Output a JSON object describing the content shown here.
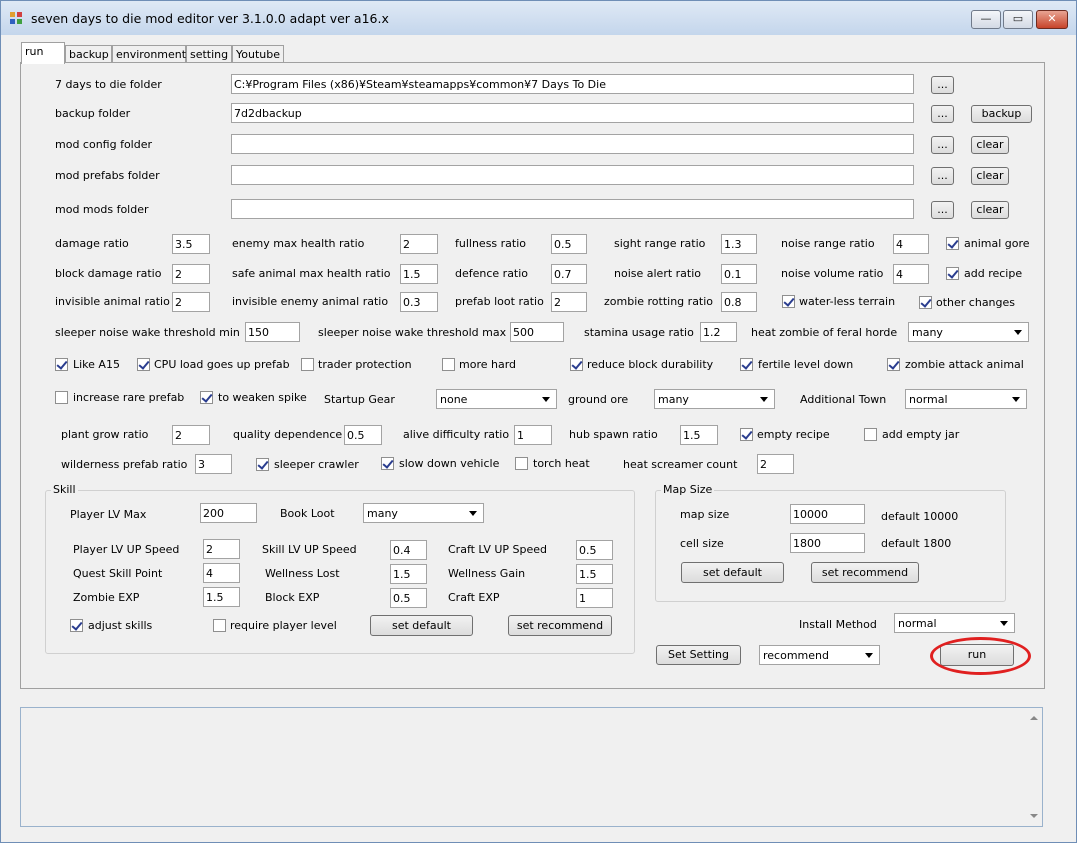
{
  "window": {
    "title": "seven days to die mod editor ver 3.1.0.0 adapt ver a16.x",
    "minimize_glyph": "—",
    "maximize_glyph": "▭",
    "close_glyph": "✕"
  },
  "tabs": [
    "run",
    "backup",
    "environment",
    "setting",
    "Youtube"
  ],
  "folders": [
    {
      "label": "7 days to die folder",
      "value": "C:¥Program Files (x86)¥Steam¥steamapps¥common¥7 Days To Die",
      "browse": "...",
      "action": ""
    },
    {
      "label": "backup folder",
      "value": "7d2dbackup",
      "browse": "...",
      "action": "backup"
    },
    {
      "label": "mod config folder",
      "value": "",
      "browse": "...",
      "action": "clear"
    },
    {
      "label": "mod prefabs folder",
      "value": "",
      "browse": "...",
      "action": "clear"
    },
    {
      "label": "mod mods folder",
      "value": "",
      "browse": "...",
      "action": "clear"
    }
  ],
  "ratios_row1": [
    {
      "label": "damage ratio",
      "value": "3.5"
    },
    {
      "label": "enemy max health ratio",
      "value": "2"
    },
    {
      "label": "fullness ratio",
      "value": "0.5"
    },
    {
      "label": "sight range ratio",
      "value": "1.3"
    },
    {
      "label": "noise range ratio",
      "value": "4"
    }
  ],
  "ratios_row2": [
    {
      "label": "block damage ratio",
      "value": "2"
    },
    {
      "label": "safe animal max health ratio",
      "value": "1.5"
    },
    {
      "label": "defence ratio",
      "value": "0.7"
    },
    {
      "label": "noise alert ratio",
      "value": "0.1"
    },
    {
      "label": "noise volume ratio",
      "value": "4"
    }
  ],
  "ratios_row3": [
    {
      "label": "invisible animal ratio",
      "value": "2"
    },
    {
      "label": "invisible enemy animal ratio",
      "value": "0.3"
    },
    {
      "label": "prefab loot ratio",
      "value": "2"
    },
    {
      "label": "zombie rotting ratio",
      "value": "0.8"
    }
  ],
  "side_checks": {
    "animal_gore": {
      "label": "animal gore",
      "checked": true
    },
    "add_recipe": {
      "label": "add recipe",
      "checked": true
    },
    "water_less": {
      "label": "water-less terrain",
      "checked": true
    },
    "other_changes": {
      "label": "other changes",
      "checked": true
    }
  },
  "sleeper": {
    "min_label": "sleeper noise wake threshold min",
    "min_value": "150",
    "max_label": "sleeper noise wake threshold max",
    "max_value": "500",
    "stamina_label": "stamina usage ratio",
    "stamina_value": "1.2",
    "heat_label": "heat zombie of feral horde",
    "heat_value": "many"
  },
  "checks_row1": [
    {
      "label": "Like A15",
      "checked": true
    },
    {
      "label": "CPU load goes up prefab",
      "checked": true
    },
    {
      "label": "trader protection",
      "checked": false
    },
    {
      "label": "more hard",
      "checked": false
    },
    {
      "label": "reduce block durability",
      "checked": true
    },
    {
      "label": "fertile level down",
      "checked": true
    },
    {
      "label": "zombie attack animal",
      "checked": true
    }
  ],
  "row_prefab": {
    "rare": {
      "label": "increase rare prefab",
      "checked": false
    },
    "spike": {
      "label": "to weaken spike",
      "checked": true
    },
    "gear_label": "Startup Gear",
    "gear_value": "none",
    "ore_label": "ground ore",
    "ore_value": "many",
    "town_label": "Additional Town",
    "town_value": "normal"
  },
  "row_plant": {
    "plant_label": "plant grow ratio",
    "plant_value": "2",
    "quality_label": "quality dependence",
    "quality_value": "0.5",
    "alive_label": "alive difficulty ratio",
    "alive_value": "1",
    "hub_label": "hub spawn ratio",
    "hub_value": "1.5",
    "empty_recipe": {
      "label": "empty recipe",
      "checked": true
    },
    "empty_jar": {
      "label": "add empty jar",
      "checked": false
    }
  },
  "row_wild": {
    "wild_label": "wilderness prefab ratio",
    "wild_value": "3",
    "crawler": {
      "label": "sleeper crawler",
      "checked": true
    },
    "vehicle": {
      "label": "slow down vehicle",
      "checked": true
    },
    "torch": {
      "label": "torch heat",
      "checked": false
    },
    "screamer_label": "heat screamer count",
    "screamer_value": "2"
  },
  "skill": {
    "title": "Skill",
    "lv_max_label": "Player LV Max",
    "lv_max_value": "200",
    "book_label": "Book Loot",
    "book_value": "many",
    "player_speed_label": "Player LV UP Speed",
    "player_speed_value": "2",
    "skill_speed_label": "Skill LV UP Speed",
    "skill_speed_value": "0.4",
    "craft_speed_label": "Craft LV UP Speed",
    "craft_speed_value": "0.5",
    "quest_label": "Quest Skill Point",
    "quest_value": "4",
    "wellness_lost_label": "Wellness Lost",
    "wellness_lost_value": "1.5",
    "wellness_gain_label": "Wellness Gain",
    "wellness_gain_value": "1.5",
    "zombie_exp_label": "Zombie EXP",
    "zombie_exp_value": "1.5",
    "block_exp_label": "Block EXP",
    "block_exp_value": "0.5",
    "craft_exp_label": "Craft EXP",
    "craft_exp_value": "1",
    "adjust": {
      "label": "adjust skills",
      "checked": true
    },
    "require": {
      "label": "require player level",
      "checked": false
    },
    "set_default": "set default",
    "set_recommend": "set recommend"
  },
  "map": {
    "title": "Map Size",
    "map_label": "map size",
    "map_value": "10000",
    "map_default": "default 10000",
    "cell_label": "cell size",
    "cell_value": "1800",
    "cell_default": "default 1800",
    "set_default": "set default",
    "set_recommend": "set recommend"
  },
  "install": {
    "label": "Install Method",
    "value": "normal"
  },
  "footer": {
    "set_setting": "Set Setting",
    "setting_value": "recommend",
    "run": "run"
  },
  "colors": {
    "highlight": "#e02020",
    "title_gradient_top": "#dfe9f5"
  }
}
